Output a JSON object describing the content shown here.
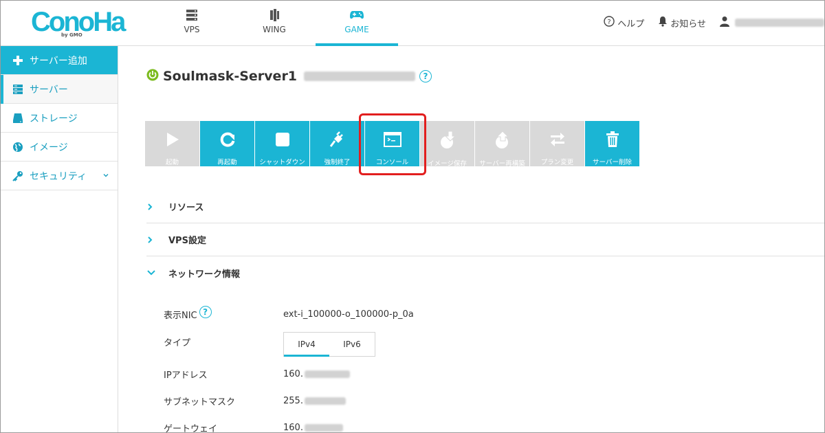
{
  "brand": {
    "logo_text": "ConoHa",
    "logo_sub": "by GMO",
    "accent": "#1bb5d4"
  },
  "topnav": [
    {
      "label": "VPS",
      "icon": "server-stack-icon",
      "active": false
    },
    {
      "label": "WING",
      "icon": "wing-icon",
      "active": false
    },
    {
      "label": "GAME",
      "icon": "gamepad-icon",
      "active": true
    }
  ],
  "header_right": {
    "help": "ヘルプ",
    "notice": "お知らせ"
  },
  "sidebar": [
    {
      "label": "サーバー追加",
      "icon": "plus-icon"
    },
    {
      "label": "サーバー",
      "icon": "server-icon"
    },
    {
      "label": "ストレージ",
      "icon": "storage-icon"
    },
    {
      "label": "イメージ",
      "icon": "globe-icon"
    },
    {
      "label": "セキュリティ",
      "icon": "key-icon"
    }
  ],
  "server": {
    "name": "Soulmask-Server1",
    "status_color": "#7cbb1f"
  },
  "actions": [
    {
      "label": "起動",
      "icon": "play-icon",
      "enabled": false
    },
    {
      "label": "再起動",
      "icon": "restart-icon",
      "enabled": true
    },
    {
      "label": "シャットダウン",
      "icon": "stop-icon",
      "enabled": true
    },
    {
      "label": "強制終了",
      "icon": "plug-icon",
      "enabled": true
    },
    {
      "label": "コンソール",
      "icon": "console-icon",
      "enabled": true
    },
    {
      "label": "イメージ保存",
      "icon": "image-save-icon",
      "enabled": false
    },
    {
      "label": "サーバー再構築",
      "icon": "rebuild-icon",
      "enabled": false
    },
    {
      "label": "プラン変更",
      "icon": "swap-icon",
      "enabled": false
    },
    {
      "label": "サーバー削除",
      "icon": "trash-icon",
      "enabled": true
    }
  ],
  "sections": [
    {
      "label": "リソース",
      "expanded": false
    },
    {
      "label": "VPS設定",
      "expanded": false
    },
    {
      "label": "ネットワーク情報",
      "expanded": true
    }
  ],
  "network": {
    "nic_label": "表示NIC",
    "nic_value": "ext-i_100000-o_100000-p_0a",
    "type_label": "タイプ",
    "type_tabs": [
      "IPv4",
      "IPv6"
    ],
    "ip_label": "IPアドレス",
    "ip_prefix": "160.",
    "mask_label": "サブネットマスク",
    "mask_prefix": "255.",
    "gateway_label": "ゲートウェイ",
    "gateway_prefix": "160."
  }
}
